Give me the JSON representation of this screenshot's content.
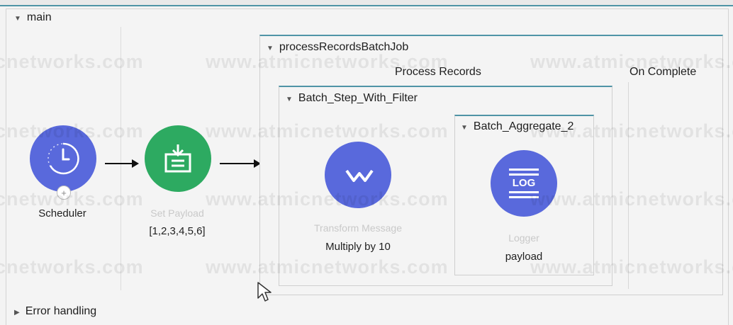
{
  "flow": {
    "name": "main",
    "components": {
      "scheduler": {
        "label": "Scheduler",
        "color": "#5969dc",
        "icon": "clock-icon"
      },
      "set_payload": {
        "label": "Set Payload",
        "value": "[1,2,3,4,5,6]",
        "color": "#2daa61",
        "icon": "set-payload-icon"
      }
    },
    "batch_job": {
      "name": "processRecordsBatchJob",
      "sections": {
        "process_records": "Process Records",
        "on_complete": "On Complete"
      },
      "batch_step": {
        "name": "Batch_Step_With_Filter",
        "transform": {
          "label": "Transform Message",
          "note": "Multiply by 10",
          "color": "#5969dc",
          "icon": "transform-icon"
        },
        "aggregator": {
          "name": "Batch_Aggregate_2",
          "logger": {
            "label": "Logger",
            "note": "payload",
            "color": "#5969dc",
            "icon": "log-icon",
            "icon_text": "LOG"
          }
        }
      }
    },
    "error_handling": "Error handling"
  },
  "watermark": "www.atmicnetworks.com"
}
